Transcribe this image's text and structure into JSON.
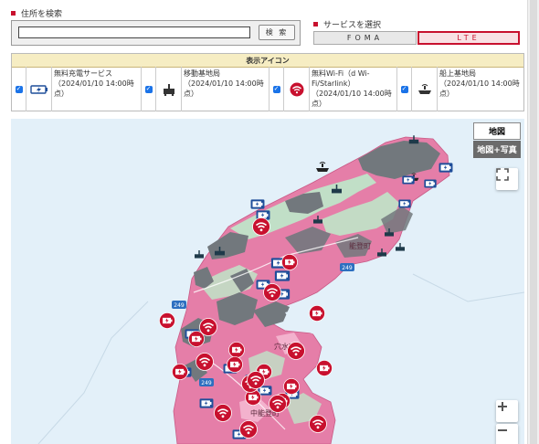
{
  "search": {
    "label": "住所を検索",
    "input_value": "",
    "button_label": "検 索"
  },
  "service": {
    "label": "サービスを選択",
    "options": [
      "FOMA",
      "LTE"
    ],
    "selected": "LTE"
  },
  "legend": {
    "title": "表示アイコン",
    "items": [
      {
        "icon": "charging-battery-icon",
        "label": "無料充電サービス（2024/01/10 14:00時点）",
        "checked": true
      },
      {
        "icon": "mobile-base-station-icon",
        "label": "移動基地局（2024/01/10 14:00時点）",
        "checked": true
      },
      {
        "icon": "wifi-icon",
        "label": "無料Wi-Fi（d Wi-Fi/Starlink）（2024/01/10 14:00時点）",
        "checked": true
      },
      {
        "icon": "ship-base-station-icon",
        "label": "船上基地局（2024/01/10 14:00時点）",
        "checked": true
      }
    ]
  },
  "map": {
    "type_buttons": [
      "地図",
      "地図+写真"
    ],
    "active_type": "地図",
    "place_labels": [
      "能登町",
      "穴水町",
      "中能登町"
    ],
    "road_labels": [
      "249",
      "249",
      "249"
    ],
    "controls": [
      "fullscreen",
      "zoom-in",
      "zoom-out"
    ],
    "colors": {
      "sea": "#e3f0f9",
      "lte_coverage": "#e57ea8",
      "lte_sub": "#f3b2cd",
      "outage": "#72787d",
      "land": "#bfe5c8",
      "accent": "#c8102e"
    }
  }
}
